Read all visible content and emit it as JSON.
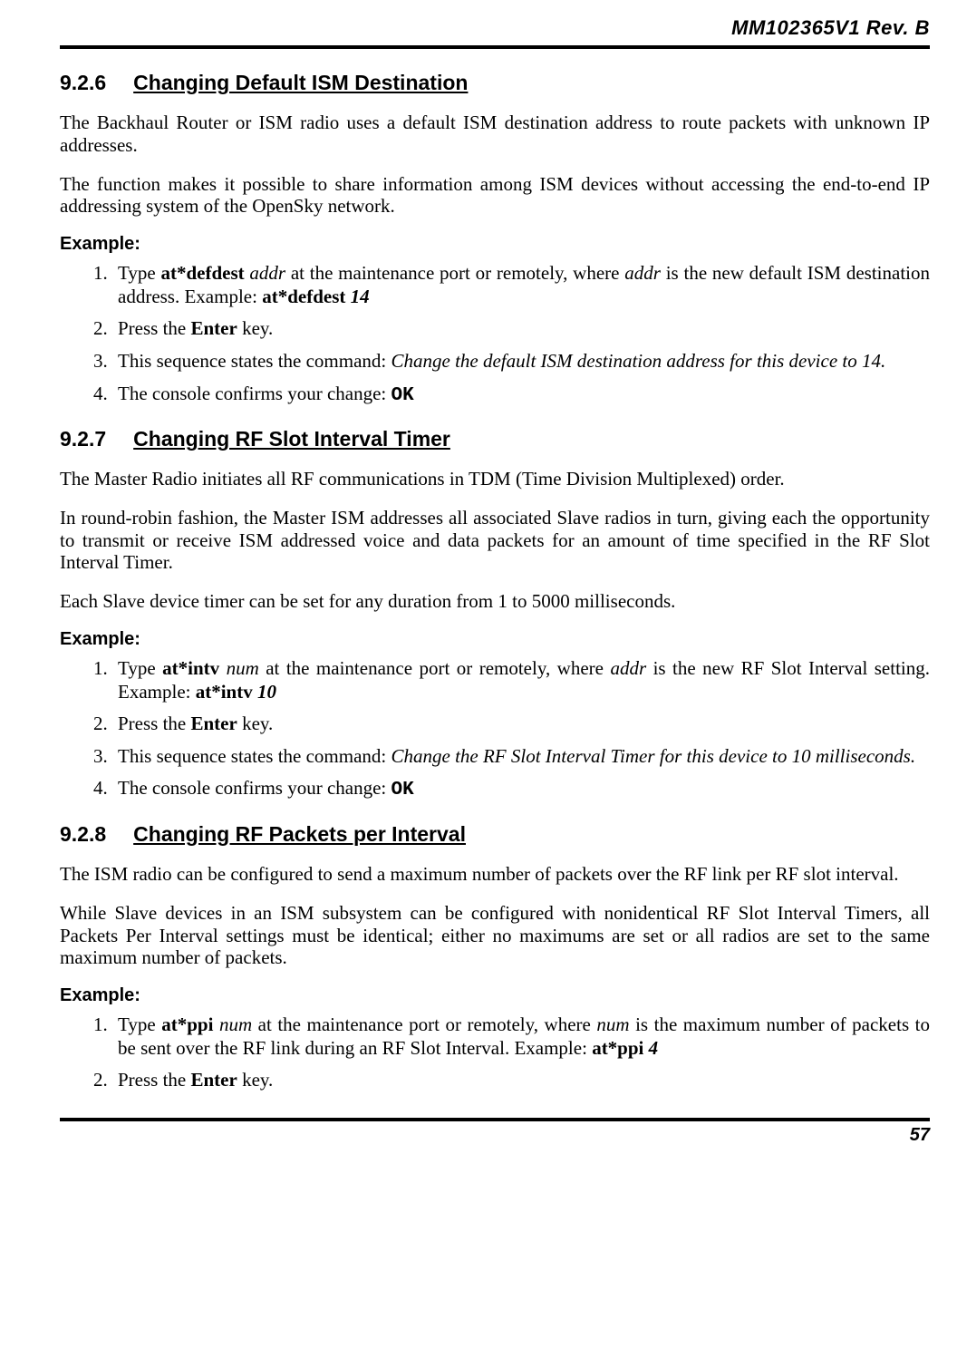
{
  "header": {
    "doc_id": "MM102365V1 Rev. B"
  },
  "footer": {
    "page_no": "57"
  },
  "sections": [
    {
      "num": "9.2.6",
      "title": "Changing Default ISM Destination",
      "paras": [
        "The Backhaul Router or ISM radio uses a default ISM destination address to route packets with unknown IP addresses.",
        "The function makes it possible to share information among ISM devices without accessing the end-to-end IP addressing system of the OpenSky network."
      ],
      "example_label": "Example:",
      "steps": [
        {
          "pre": "Type ",
          "cmd": "at*defdest",
          "arg": "addr",
          "mid1": " at the maintenance port or remotely, where ",
          "arg2": "addr",
          "mid2": " is the new default ISM destination address. Example: ",
          "ex_cmd": "at*defdest",
          "ex_arg": "14"
        },
        {
          "pre": "Press the ",
          "key": "Enter",
          "post": " key."
        },
        {
          "pre": "This sequence states the command:  ",
          "ital": "Change the default ISM destination address for this device to 14."
        },
        {
          "pre": "The console confirms your change: ",
          "ok": "OK"
        }
      ]
    },
    {
      "num": "9.2.7",
      "title": "Changing RF Slot Interval Timer",
      "paras": [
        "The Master Radio initiates all RF communications in TDM (Time Division Multiplexed) order.",
        "In round-robin fashion, the Master ISM addresses all associated Slave radios in turn, giving each the opportunity to transmit or receive ISM addressed voice and data packets for an amount of time specified in the RF Slot Interval Timer.",
        "Each Slave device timer can be set for any duration from 1 to 5000 milliseconds."
      ],
      "example_label": "Example:",
      "steps": [
        {
          "pre": "Type ",
          "cmd": "at*intv",
          "arg": "num",
          "mid1": " at the maintenance port or remotely, where ",
          "arg2": "addr",
          "mid2": " is the new RF Slot Interval setting. Example: ",
          "ex_cmd": "at*intv",
          "ex_arg": "10"
        },
        {
          "pre": "Press the ",
          "key": "Enter",
          "post": " key."
        },
        {
          "pre": "This sequence states the command: ",
          "ital": "Change the RF Slot Interval Timer for this device to 10 milliseconds."
        },
        {
          "pre": "The console confirms your change: ",
          "ok": "OK"
        }
      ]
    },
    {
      "num": "9.2.8",
      "title": "Changing RF Packets per Interval",
      "paras": [
        "The ISM radio can be configured to send a maximum number of packets over the RF link per RF slot interval.",
        "While Slave devices in an ISM subsystem can be configured with nonidentical RF Slot Interval Timers, all Packets Per Interval settings must be identical; either no maximums are set or all radios are set to the same maximum number of packets."
      ],
      "example_label": "Example:",
      "steps": [
        {
          "pre": "Type ",
          "cmd": "at*ppi",
          "arg": "num",
          "mid1": " at the maintenance port or remotely, where ",
          "arg2": "num",
          "mid2": " is the maximum number of packets to be sent over the RF link during an RF Slot Interval. Example: ",
          "ex_cmd": "at*ppi",
          "ex_arg": "4"
        },
        {
          "pre": "Press the ",
          "key": "Enter",
          "post": " key."
        }
      ]
    }
  ]
}
